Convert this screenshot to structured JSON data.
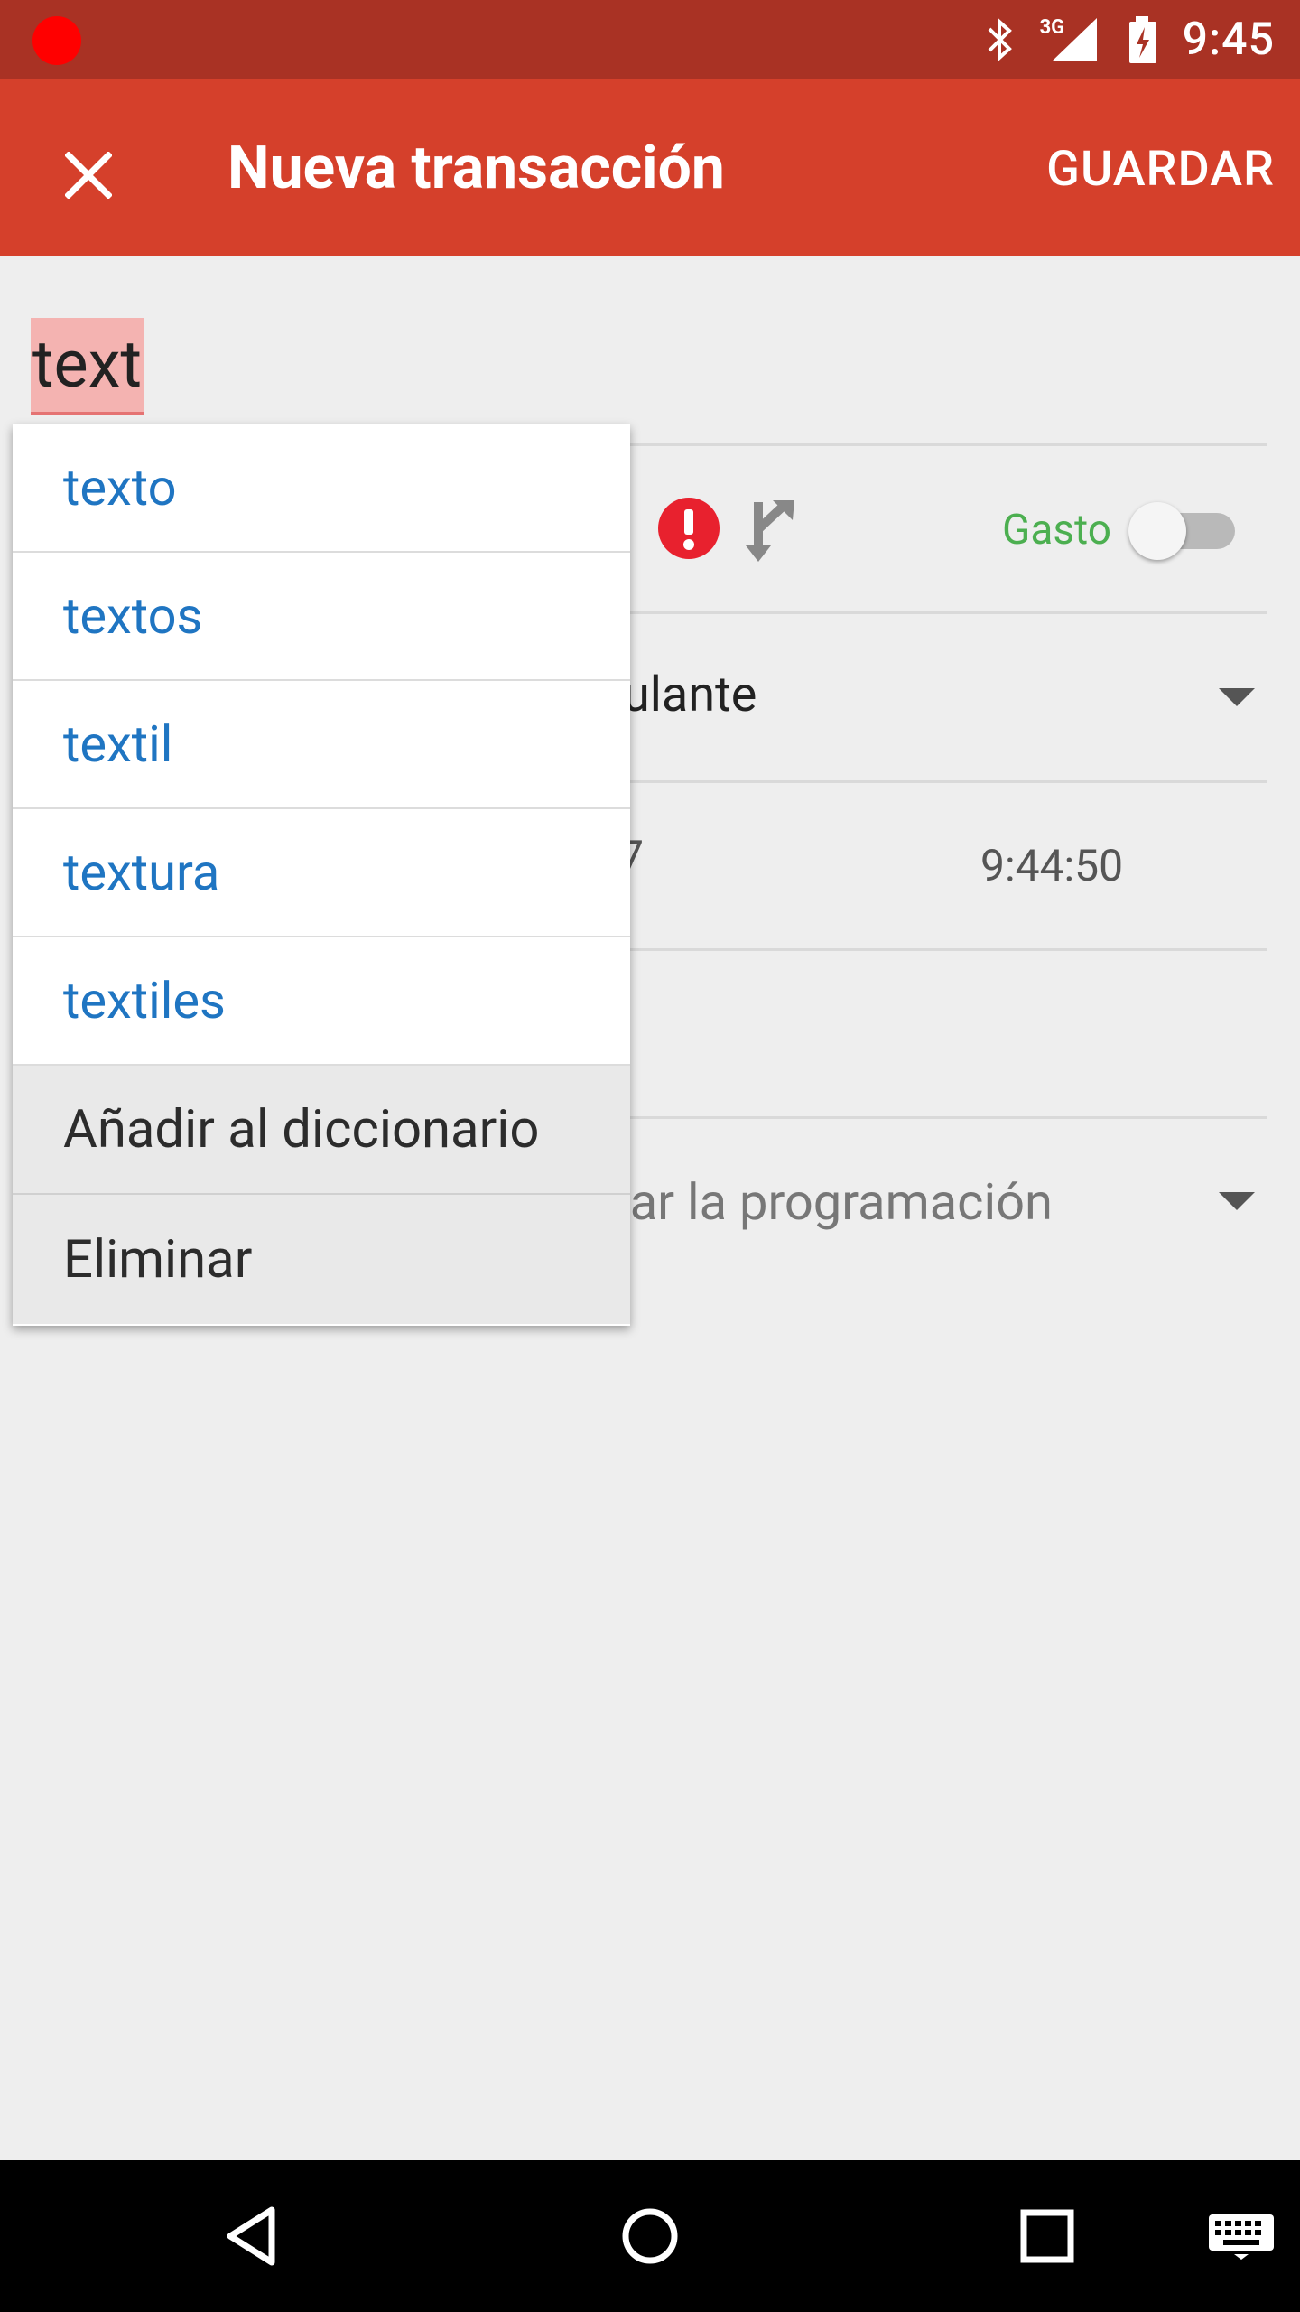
{
  "status_bar": {
    "time": "9:45",
    "network_label": "3G",
    "icons": [
      "recording-dot",
      "bluetooth-icon",
      "signal-icon",
      "battery-charging-icon"
    ]
  },
  "app_bar": {
    "close_icon": "close-icon",
    "title": "Nueva transacción",
    "save_label": "GUARDAR",
    "color": "#d5402b"
  },
  "form": {
    "description_value": "text",
    "type_label": "Gasto",
    "type_color": "#4caf50",
    "account_fragment": "ulante",
    "date_fragment": "7",
    "time_value": "9:44:50",
    "schedule_fragment": "ear la programación"
  },
  "suggestions": {
    "items": [
      "texto",
      "textos",
      "textil",
      "textura",
      "textiles"
    ],
    "add_to_dictionary": "Añadir al diccionario",
    "delete": "Eliminar"
  },
  "nav_bar": {
    "icons": [
      "back-icon",
      "home-icon",
      "recents-icon",
      "keyboard-icon"
    ]
  }
}
